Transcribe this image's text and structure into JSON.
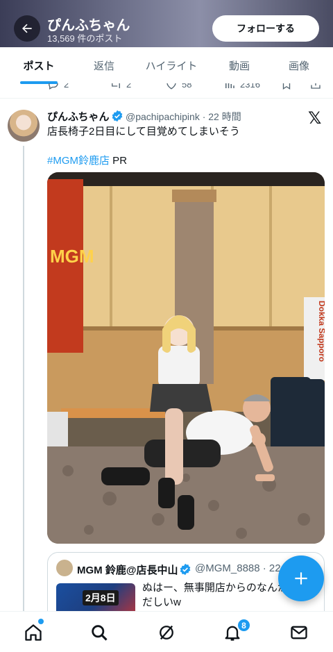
{
  "header": {
    "title": "ぴんふちゃん",
    "post_count": "13,569 件のポスト",
    "follow_label": "フォローする"
  },
  "tabs": [
    {
      "label": "ポスト",
      "active": true
    },
    {
      "label": "返信",
      "active": false
    },
    {
      "label": "ハイライト",
      "active": false
    },
    {
      "label": "動画",
      "active": false
    },
    {
      "label": "画像",
      "active": false
    }
  ],
  "prev_post_actions": {
    "replies": "2",
    "reposts": "2",
    "likes": "58",
    "views": "2316"
  },
  "tweet": {
    "name": "ぴんふちゃん",
    "handle_time": "@pachipachipink · 22 時間",
    "text": "店長椅子2日目にして目覚めてしまいそう",
    "hashtag": "#MGM鈴鹿店",
    "tag_suffix": " PR",
    "photo_sign_text": "MGM",
    "photo_banner_text": "Dokka Sapporo"
  },
  "quote": {
    "name": "MGM 鈴鹿@店長中山",
    "handle_time": "@MGM_8888 · 22",
    "thumb_text": "2月8日",
    "text": "ぬはー、無事開店からのなんか慌ただしいw"
  },
  "bottom_nav": {
    "notification_count": "8"
  },
  "colors": {
    "accent": "#1d9bf0",
    "text_primary": "#0f1419",
    "text_secondary": "#536471"
  }
}
